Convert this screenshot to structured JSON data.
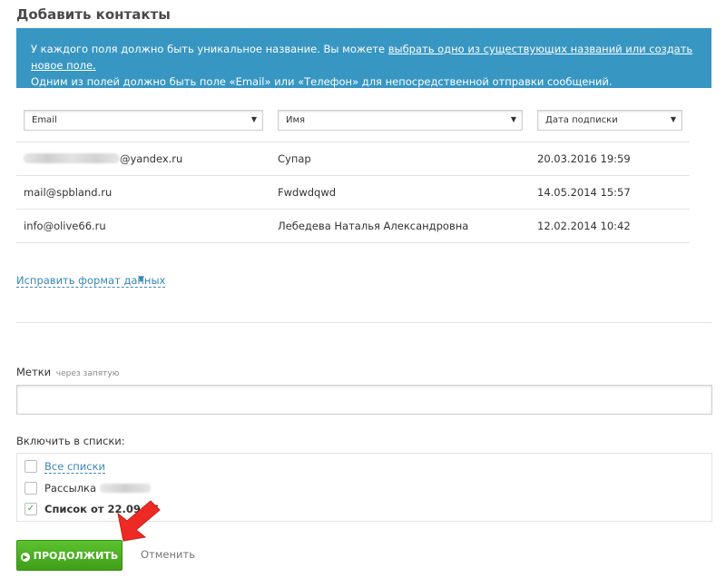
{
  "page": {
    "title": "Добавить контакты"
  },
  "info": {
    "line1_prefix": "У каждого поля должно быть уникальное название. Вы можете ",
    "line1_link": "выбрать одно из существующих названий или создать новое поле.",
    "line2": "Одним из полей должно быть поле «Email» или «Телефон» для непосредственной отправки сообщений."
  },
  "columns": [
    {
      "selected": "Email"
    },
    {
      "selected": "Имя"
    },
    {
      "selected": "Дата подписки"
    }
  ],
  "rows": [
    {
      "email_suffix": "@yandex.ru",
      "name": "Супар",
      "date": "20.03.2016 19:59"
    },
    {
      "email": "mail@spbland.ru",
      "name": "Fwdwdqwd",
      "date": "14.05.2014 15:57"
    },
    {
      "email": "info@olive66.ru",
      "name": "Лебедева Наталья Александровна",
      "date": "12.02.2014 10:42"
    }
  ],
  "fix_format": {
    "label": "Исправить формат данных"
  },
  "tags": {
    "label": "Метки",
    "hint": "через запятую",
    "value": ""
  },
  "lists": {
    "label": "Включить в списки:",
    "all": {
      "label": "Все списки",
      "checked": false
    },
    "mailing": {
      "label": "Рассылка",
      "checked": false
    },
    "list_sept": {
      "label": "Список от 22.09.16",
      "checked": true
    }
  },
  "actions": {
    "continue_label": "ПРОДОЛЖИТЬ",
    "cancel_label": "Отменить"
  },
  "colors": {
    "info_bg": "#3796c2",
    "button_green": "#4caf24",
    "link": "#3a87b7",
    "arrow": "#ee2a24"
  }
}
